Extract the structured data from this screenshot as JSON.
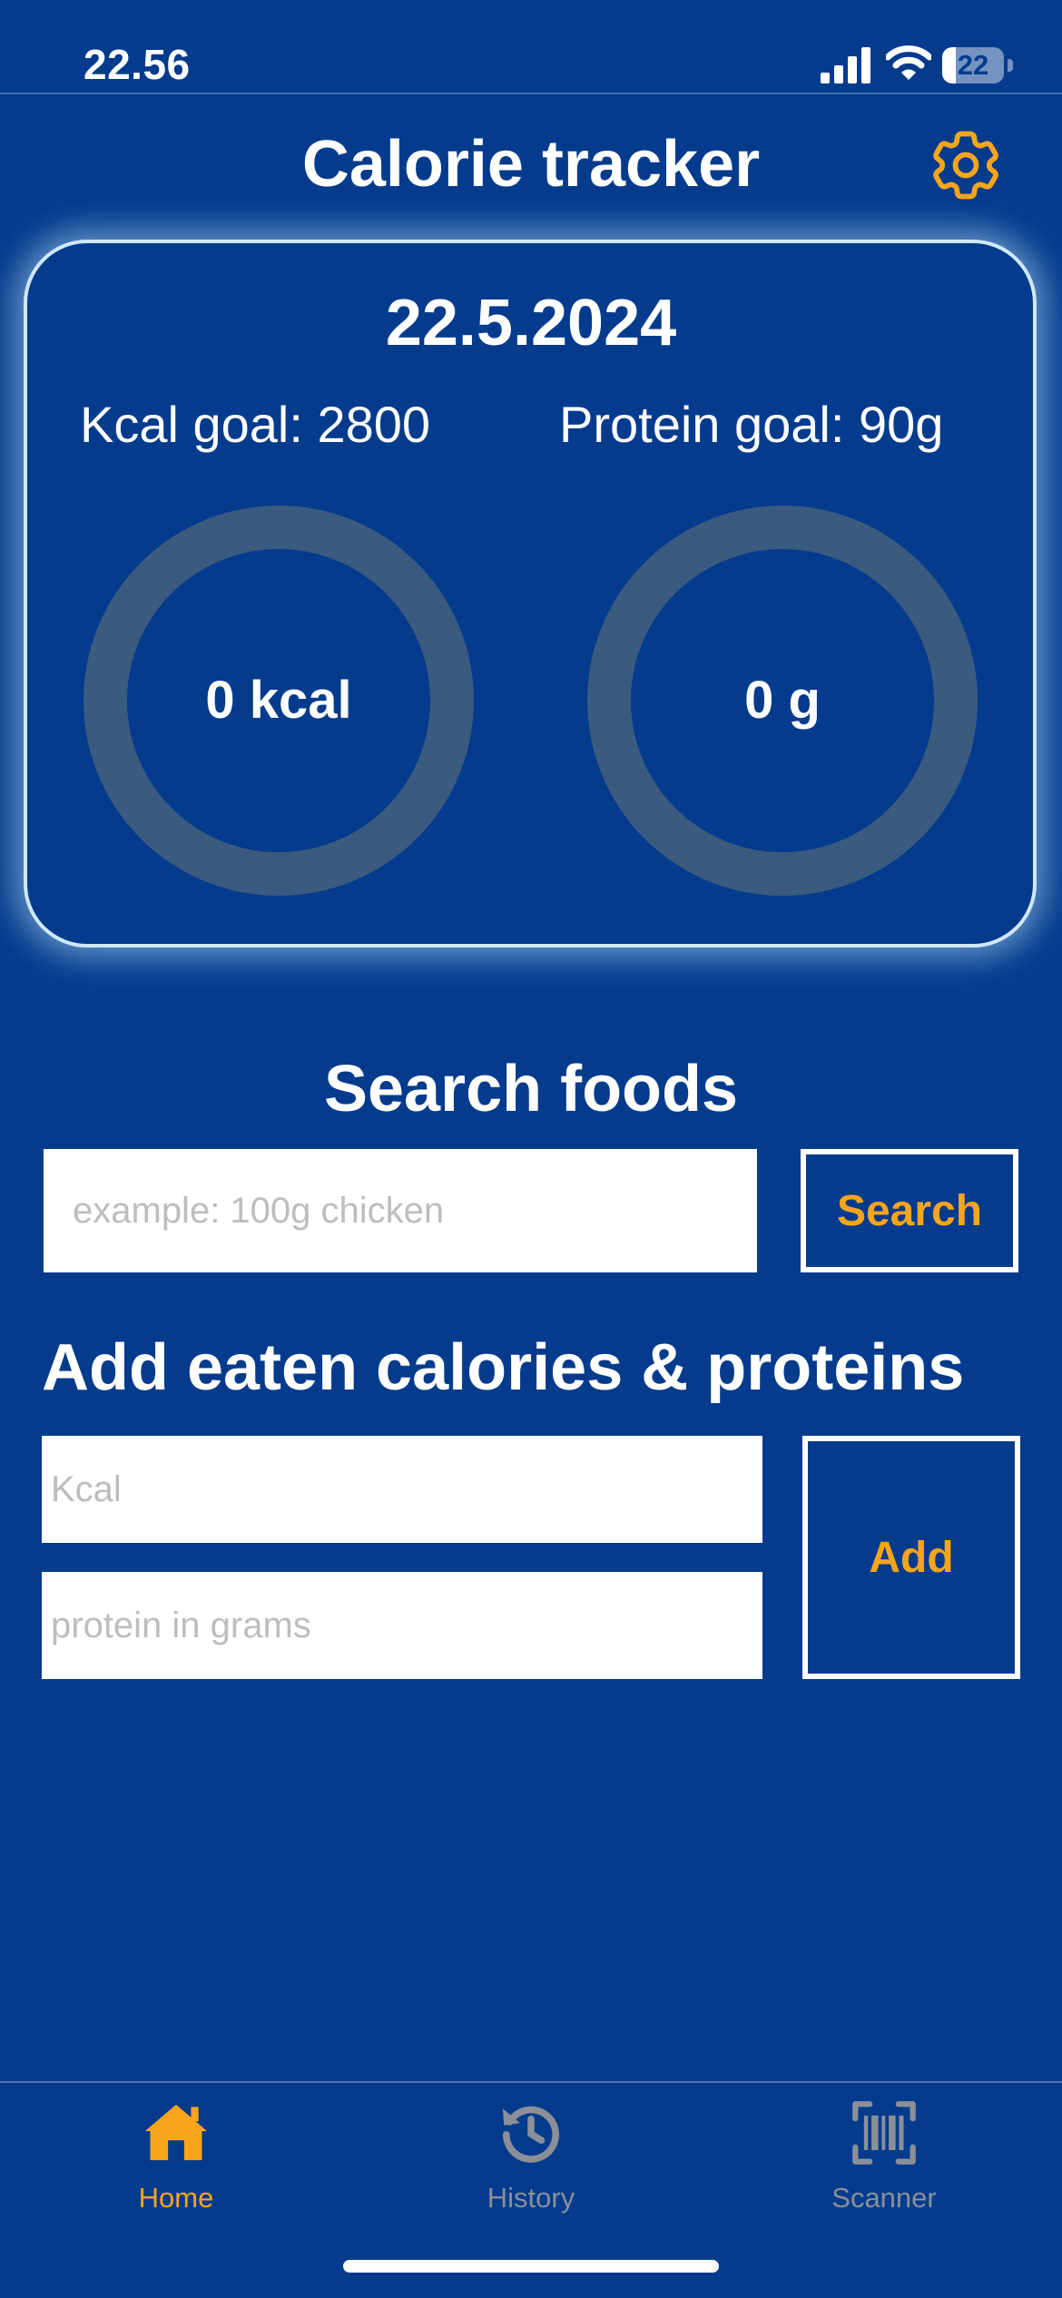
{
  "status_bar": {
    "time": "22.56",
    "battery": "22",
    "battery_level": 0.22
  },
  "header": {
    "title": "Calorie tracker",
    "settings_icon": "gear-icon"
  },
  "summary": {
    "date": "22.5.2024",
    "kcal_goal_label": "Kcal goal: 2800",
    "protein_goal_label": "Protein goal: 90g",
    "kcal_value": "0 kcal",
    "protein_value": "0 g",
    "kcal_progress": 0,
    "protein_progress": 0
  },
  "search": {
    "heading": "Search foods",
    "input_placeholder": "example: 100g chicken",
    "input_value": "",
    "button_label": "Search"
  },
  "add": {
    "heading": "Add eaten calories & proteins",
    "kcal_placeholder": "Kcal",
    "protein_placeholder": "protein in grams",
    "button_label": "Add"
  },
  "tabs": [
    {
      "label": "Home",
      "icon": "home-icon",
      "active": true
    },
    {
      "label": "History",
      "icon": "history-icon",
      "active": false
    },
    {
      "label": "Scanner",
      "icon": "barcode-scanner-icon",
      "active": false
    }
  ],
  "colors": {
    "background": "#043b8c",
    "accent": "#f8a51c",
    "ring_track": "#3a5a80",
    "inactive_tab": "#8a8f99",
    "card_border": "#cfe8ff"
  }
}
